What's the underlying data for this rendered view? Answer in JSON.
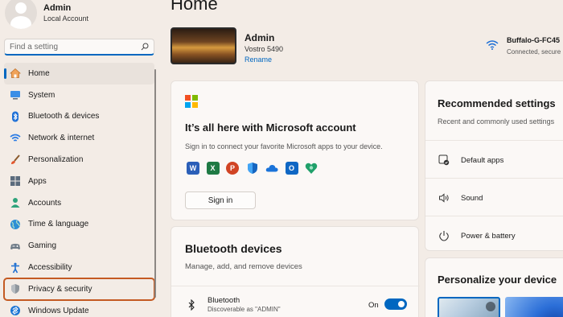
{
  "profile": {
    "name": "Admin",
    "account_type": "Local Account"
  },
  "search": {
    "placeholder": "Find a setting"
  },
  "sidebar": {
    "items": [
      {
        "label": "Home",
        "icon": "home-icon"
      },
      {
        "label": "System",
        "icon": "system-icon"
      },
      {
        "label": "Bluetooth & devices",
        "icon": "bluetooth-icon"
      },
      {
        "label": "Network & internet",
        "icon": "wifi-icon"
      },
      {
        "label": "Personalization",
        "icon": "brush-icon"
      },
      {
        "label": "Apps",
        "icon": "apps-icon"
      },
      {
        "label": "Accounts",
        "icon": "accounts-icon"
      },
      {
        "label": "Time & language",
        "icon": "globe-icon"
      },
      {
        "label": "Gaming",
        "icon": "gamepad-icon"
      },
      {
        "label": "Accessibility",
        "icon": "accessibility-icon"
      },
      {
        "label": "Privacy & security",
        "icon": "shield-icon"
      },
      {
        "label": "Windows Update",
        "icon": "update-icon"
      }
    ],
    "active_index": 0,
    "highlighted_index": 10
  },
  "main": {
    "title": "Home",
    "device": {
      "name": "Admin",
      "model": "Vostro 5490",
      "rename_label": "Rename"
    },
    "network": {
      "name": "Buffalo-G-FC45",
      "status": "Connected, secure"
    },
    "ms_card": {
      "title": "It’s all here with Microsoft account",
      "subtitle": "Sign in to connect your favorite Microsoft apps to your device.",
      "apps": [
        "word-icon",
        "excel-icon",
        "powerpoint-icon",
        "defender-icon",
        "onedrive-icon",
        "outlook-icon",
        "family-icon"
      ],
      "signin_label": "Sign in"
    },
    "bt_card": {
      "title": "Bluetooth devices",
      "subtitle": "Manage, add, and remove devices",
      "item_name": "Bluetooth",
      "item_desc": "Discoverable as \"ADMIN\"",
      "toggle_label": "On",
      "toggle_on": true
    },
    "recommended": {
      "title": "Recommended settings",
      "subtitle": "Recent and commonly used settings",
      "items": [
        {
          "label": "Default apps",
          "icon": "default-apps-icon"
        },
        {
          "label": "Sound",
          "icon": "speaker-icon"
        },
        {
          "label": "Power & battery",
          "icon": "power-icon"
        }
      ]
    },
    "personalize": {
      "title": "Personalize your device"
    }
  },
  "colors": {
    "accent": "#0067c0",
    "highlight_box": "#c45a22",
    "background": "#f3ece6"
  }
}
